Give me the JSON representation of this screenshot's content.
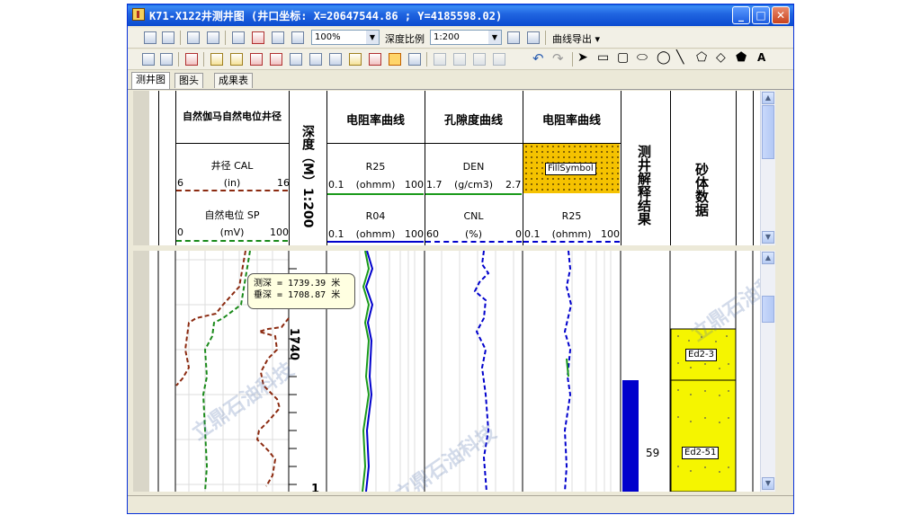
{
  "window": {
    "title": "K71-X122井测井图 (井口坐标: X=20647544.86 ; Y=4185598.02)"
  },
  "toolbar1": {
    "zoom": "100%",
    "depth_scale_label": "深度比例",
    "depth_scale_value": "1:200",
    "curve_export_label": "曲线导出"
  },
  "tabs": [
    "测井图",
    "图头",
    "成果表"
  ],
  "header": {
    "track1_title": "自然伽马自然电位井径",
    "cal": {
      "name": "井径 CAL",
      "min": "6",
      "unit": "(in)",
      "max": "16"
    },
    "sp": {
      "name": "自然电位 SP",
      "min": "0",
      "unit": "(mV)",
      "max": "100"
    },
    "depth_title": "深度（M）1:200",
    "track3_title": "电阻率曲线",
    "r25": {
      "name": "R25",
      "min": "0.1",
      "unit": "(ohmm)",
      "max": "100"
    },
    "r04": {
      "name": "R04",
      "min": "0.1",
      "unit": "(ohmm)",
      "max": "100"
    },
    "track4_title": "孔隙度曲线",
    "den": {
      "name": "DEN",
      "min": "1.7",
      "unit": "(g/cm3)",
      "max": "2.7"
    },
    "cnl": {
      "name": "CNL",
      "min": "60",
      "unit": "(%)",
      "max": "0"
    },
    "track5_title": "电阻率曲线",
    "fill_symbol": "FillSymbol",
    "r25b": {
      "name": "R25",
      "min": "0.1",
      "unit": "(ohmm)",
      "max": "100"
    },
    "track6_title": "测井解释结果",
    "track7_title": "砂体数据"
  },
  "body": {
    "depth_mark": "1740",
    "depth_mark_partial": "1",
    "tooltip": {
      "line1": "测深 = 1739.39 米",
      "line2": "垂深 = 1708.87 米"
    },
    "interp_value": "59",
    "sand1": "Ed2-3",
    "sand2": "Ed2-51"
  },
  "watermark": "立鼎石油科技",
  "colors": {
    "title_blue": "#0c4bd0",
    "sand_yellow": "#f5f500",
    "bar_blue": "#0000cc"
  }
}
